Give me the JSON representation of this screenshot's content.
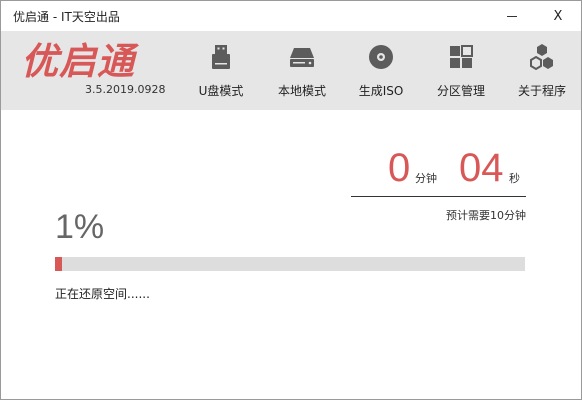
{
  "window": {
    "title": "优启通 - IT天空出品",
    "close_label": "X"
  },
  "header": {
    "logo": "优启通",
    "version": "3.5.2019.0928"
  },
  "toolbar": {
    "items": [
      {
        "label": "U盘模式",
        "icon": "usb-drive-icon"
      },
      {
        "label": "本地模式",
        "icon": "hard-disk-icon"
      },
      {
        "label": "生成ISO",
        "icon": "disc-icon"
      },
      {
        "label": "分区管理",
        "icon": "partition-grid-icon"
      },
      {
        "label": "关于程序",
        "icon": "hexagons-icon"
      }
    ]
  },
  "timer": {
    "minutes": "0",
    "minutes_unit": "分钟",
    "seconds": "04",
    "seconds_unit": "秒",
    "estimate": "预计需要10分钟"
  },
  "progress": {
    "percent_text": "1%",
    "percent": 1.5,
    "status": "正在还原空间......"
  },
  "colors": {
    "accent": "#d85757",
    "toolbar_bg": "#e6e6e6",
    "track": "#dddddd",
    "icon": "#5c5c5c"
  }
}
